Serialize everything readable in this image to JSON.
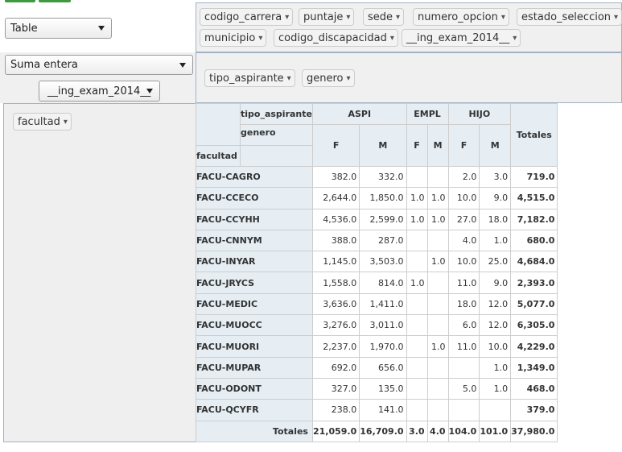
{
  "renderer": {
    "selected": "Table"
  },
  "aggregator": {
    "selected": "Suma entera"
  },
  "aggregator_attr": {
    "selected": "__ing_exam_2014__"
  },
  "unused_attrs": [
    "codigo_carrera",
    "puntaje",
    "sede",
    "numero_opcion",
    "estado_seleccion",
    "municipio",
    "codigo_discapacidad",
    "__ing_exam_2014__"
  ],
  "col_attrs": [
    "tipo_aspirante",
    "genero"
  ],
  "row_attrs": [
    "facultad"
  ],
  "pill_arrow": "▾",
  "table": {
    "corner_row_label": "facultad",
    "col_attr_labels": [
      "tipo_aspirante",
      "genero"
    ],
    "groups": [
      {
        "label": "ASPI",
        "subs": [
          "F",
          "M"
        ]
      },
      {
        "label": "EMPL",
        "subs": [
          "F",
          "M"
        ]
      },
      {
        "label": "HIJO",
        "subs": [
          "F",
          "M"
        ]
      }
    ],
    "totals_label": "Totales",
    "rows": [
      {
        "label": "FACU-CAGRO",
        "cells": [
          "382.0",
          "332.0",
          "",
          "",
          "2.0",
          "3.0"
        ],
        "total": "719.0"
      },
      {
        "label": "FACU-CCECO",
        "cells": [
          "2,644.0",
          "1,850.0",
          "1.0",
          "1.0",
          "10.0",
          "9.0"
        ],
        "total": "4,515.0"
      },
      {
        "label": "FACU-CCYHH",
        "cells": [
          "4,536.0",
          "2,599.0",
          "1.0",
          "1.0",
          "27.0",
          "18.0"
        ],
        "total": "7,182.0"
      },
      {
        "label": "FACU-CNNYM",
        "cells": [
          "388.0",
          "287.0",
          "",
          "",
          "4.0",
          "1.0"
        ],
        "total": "680.0"
      },
      {
        "label": "FACU-INYAR",
        "cells": [
          "1,145.0",
          "3,503.0",
          "",
          "1.0",
          "10.0",
          "25.0"
        ],
        "total": "4,684.0"
      },
      {
        "label": "FACU-JRYCS",
        "cells": [
          "1,558.0",
          "814.0",
          "1.0",
          "",
          "11.0",
          "9.0"
        ],
        "total": "2,393.0"
      },
      {
        "label": "FACU-MEDIC",
        "cells": [
          "3,636.0",
          "1,411.0",
          "",
          "",
          "18.0",
          "12.0"
        ],
        "total": "5,077.0"
      },
      {
        "label": "FACU-MUOCC",
        "cells": [
          "3,276.0",
          "3,011.0",
          "",
          "",
          "6.0",
          "12.0"
        ],
        "total": "6,305.0"
      },
      {
        "label": "FACU-MUORI",
        "cells": [
          "2,237.0",
          "1,970.0",
          "",
          "1.0",
          "11.0",
          "10.0"
        ],
        "total": "4,229.0"
      },
      {
        "label": "FACU-MUPAR",
        "cells": [
          "692.0",
          "656.0",
          "",
          "",
          "",
          "1.0"
        ],
        "total": "1,349.0"
      },
      {
        "label": "FACU-ODONT",
        "cells": [
          "327.0",
          "135.0",
          "",
          "",
          "5.0",
          "1.0"
        ],
        "total": "468.0"
      },
      {
        "label": "FACU-QCYFR",
        "cells": [
          "238.0",
          "141.0",
          "",
          "",
          "",
          ""
        ],
        "total": "379.0"
      }
    ],
    "col_totals": [
      "21,059.0",
      "16,709.0",
      "3.0",
      "4.0",
      "104.0",
      "101.0"
    ],
    "grand_total": "37,980.0"
  }
}
